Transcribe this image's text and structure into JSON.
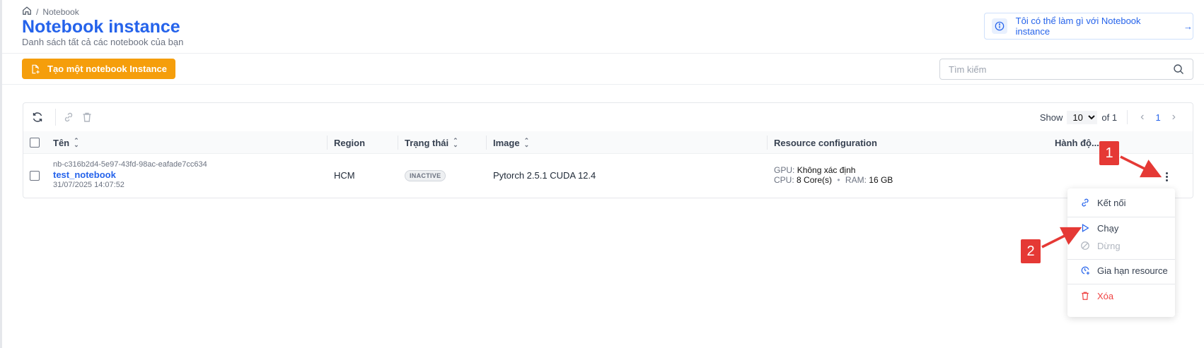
{
  "breadcrumb": {
    "current": "Notebook"
  },
  "header": {
    "title": "Notebook instance",
    "subtitle": "Danh sách tất cả các notebook của bạn",
    "help_link": "Tôi có thể làm gì với Notebook instance"
  },
  "toolbar": {
    "create_label": "Tạo một notebook Instance",
    "search_placeholder": "Tìm kiếm"
  },
  "pager": {
    "show_label": "Show",
    "page_size": "10",
    "of_label": "of 1",
    "current_page": "1"
  },
  "table": {
    "columns": [
      "Tên",
      "Region",
      "Trạng thái",
      "Image",
      "Resource configuration",
      "Hành độ..."
    ],
    "rows": [
      {
        "id": "nb-c316b2d4-5e97-43fd-98ac-eafade7cc634",
        "name": "test_notebook",
        "created": "31/07/2025 14:07:52",
        "region": "HCM",
        "status": "INACTIVE",
        "image": "Pytorch 2.5.1 CUDA 12.4",
        "gpu_label": "GPU:",
        "gpu_value": "Không xác định",
        "cpu_label": "CPU:",
        "cpu_value": "8 Core(s)",
        "ram_label": "RAM:",
        "ram_value": "16 GB"
      }
    ]
  },
  "action_menu": {
    "items": [
      "Kết nối",
      "Chạy",
      "Dừng",
      "Gia hạn resource",
      "Xóa"
    ]
  },
  "annotations": {
    "callout_1": "1",
    "callout_2": "2",
    "color": "#e53935"
  },
  "colors": {
    "primary": "#2563eb",
    "accent": "#f59e0b",
    "danger": "#ef4444"
  }
}
